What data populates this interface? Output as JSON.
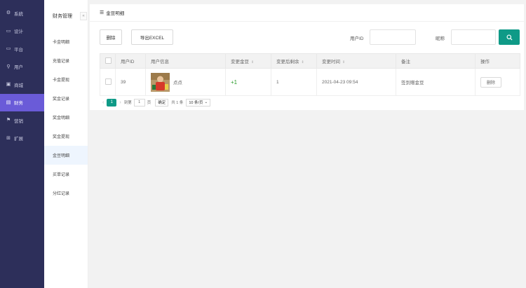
{
  "sidebar": {
    "items": [
      {
        "label": "系統",
        "icon": "gear-icon",
        "glyph": "⚙",
        "active": false
      },
      {
        "label": "设计",
        "icon": "monitor-icon",
        "glyph": "▭",
        "active": false
      },
      {
        "label": "平台",
        "icon": "monitor-icon",
        "glyph": "▭",
        "active": false
      },
      {
        "label": "用户",
        "icon": "user-icon",
        "glyph": "⚲",
        "active": false
      },
      {
        "label": "商城",
        "icon": "shop-icon",
        "glyph": "▣",
        "active": false
      },
      {
        "label": "财务",
        "icon": "finance-icon",
        "glyph": "▤",
        "active": true
      },
      {
        "label": "营销",
        "icon": "marketing-icon",
        "glyph": "⚑",
        "active": false
      },
      {
        "label": "扩展",
        "icon": "grid-icon",
        "glyph": "⊞",
        "active": false
      }
    ]
  },
  "subnav": {
    "title": "财务管理",
    "collapse_glyph": "«",
    "items": [
      {
        "label": "卡金明细",
        "active": false
      },
      {
        "label": "充值记录",
        "active": false
      },
      {
        "label": "卡金提现",
        "active": false
      },
      {
        "label": "奖金记录",
        "active": false
      },
      {
        "label": "奖金明细",
        "active": false
      },
      {
        "label": "奖金提现",
        "active": false
      },
      {
        "label": "金豆明细",
        "active": true
      },
      {
        "label": "买单记录",
        "active": false
      },
      {
        "label": "分红记录",
        "active": false
      }
    ]
  },
  "main": {
    "title": "金豆明细",
    "toolbar": {
      "delete_label": "删除",
      "export_label": "导出EXCEL",
      "user_id_label": "用户ID",
      "user_id_value": "",
      "nickname_label": "昵称",
      "nickname_value": ""
    },
    "table": {
      "columns": [
        "用户ID",
        "用户信息",
        "变更金豆",
        "变更后剩余",
        "变更时间",
        "备注",
        "操作"
      ],
      "rows": [
        {
          "user_id": "39",
          "nickname": "点点",
          "change": "+1",
          "remaining": "1",
          "time": "2021-04-23 09:54",
          "remark": "签到赠金豆",
          "action": "删除"
        }
      ]
    },
    "pager": {
      "current_page": "1",
      "goto_label": "到第",
      "goto_value": "1",
      "page_unit": "页",
      "confirm_label": "确定",
      "total_label": "共 1 条",
      "page_size_label": "10 条/页"
    }
  },
  "colors": {
    "sidebar_bg": "#2d2f5a",
    "sidebar_active": "#6a5bd8",
    "accent": "#0f9a87",
    "positive": "#2f9e2f"
  }
}
